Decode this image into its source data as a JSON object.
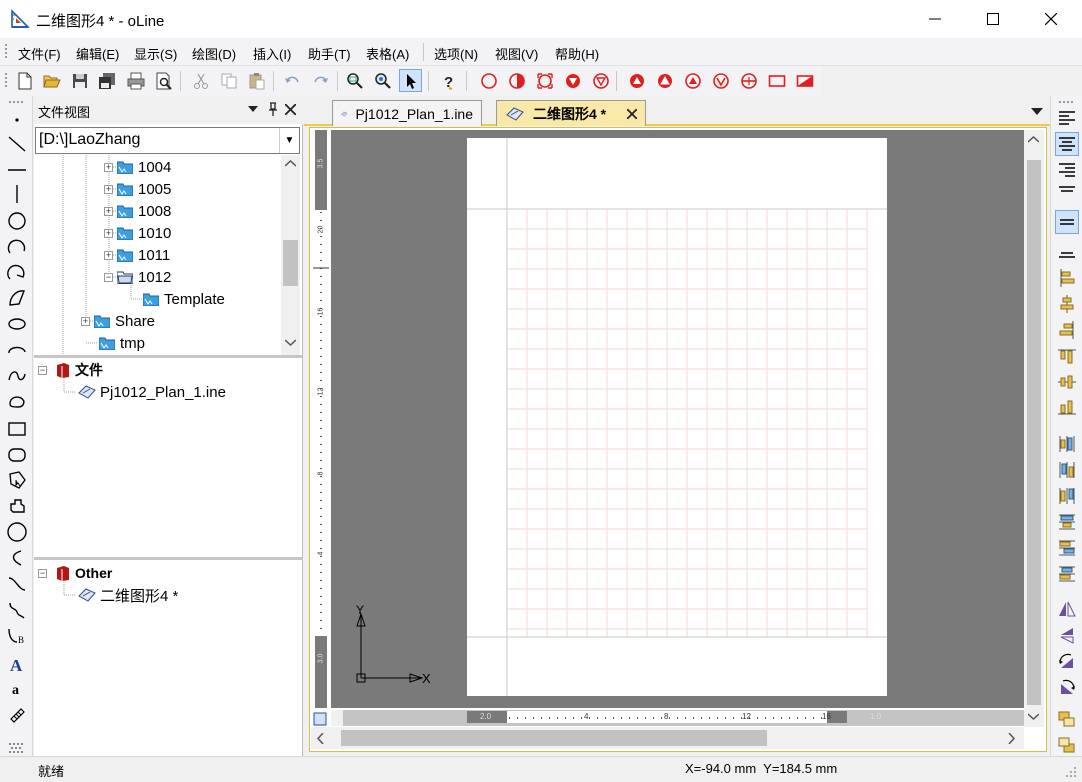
{
  "window": {
    "title": "二维图形4 * - oLine",
    "minimize_icon": "minimize-icon",
    "maximize_icon": "maximize-icon",
    "close_icon": "close-icon"
  },
  "menu": [
    "文件(F)",
    "编辑(E)",
    "显示(S)",
    "绘图(D)",
    "插入(I)",
    "助手(T)",
    "表格(A)",
    "选项(N)",
    "视图(V)",
    "帮助(H)"
  ],
  "panel": {
    "title": "文件视图",
    "drive": "[D:\\]LaoZhang",
    "tree": [
      "1004",
      "1005",
      "1008",
      "1010",
      "1011",
      "1012",
      "Template",
      "Share",
      "tmp"
    ],
    "group1": {
      "name": "文件",
      "file": "Pj1012_Plan_1.ine"
    },
    "group2": {
      "name": "Other",
      "file": "二维图形4 *"
    }
  },
  "tabs": [
    {
      "label": "Pj1012_Plan_1.ine",
      "active": false
    },
    {
      "label": "二维图形4 *",
      "active": true
    }
  ],
  "vruler": {
    "labels": [
      "3.5",
      "20",
      "16",
      "12",
      "8",
      "4",
      "3.0"
    ]
  },
  "hruler": {
    "labels": [
      "2.0",
      "4",
      "8",
      "12",
      "16",
      "1.0"
    ]
  },
  "axes": {
    "y": "Y",
    "x": "X"
  },
  "status": {
    "left": "就绪",
    "coords": "X=-94.0 mm  Y=184.5 mm"
  },
  "colors": {
    "accent_tab": "#f8e9a8",
    "grid": "#f3d9d0",
    "canvas": "#7a7a7a",
    "red_tools": "#e02020"
  }
}
